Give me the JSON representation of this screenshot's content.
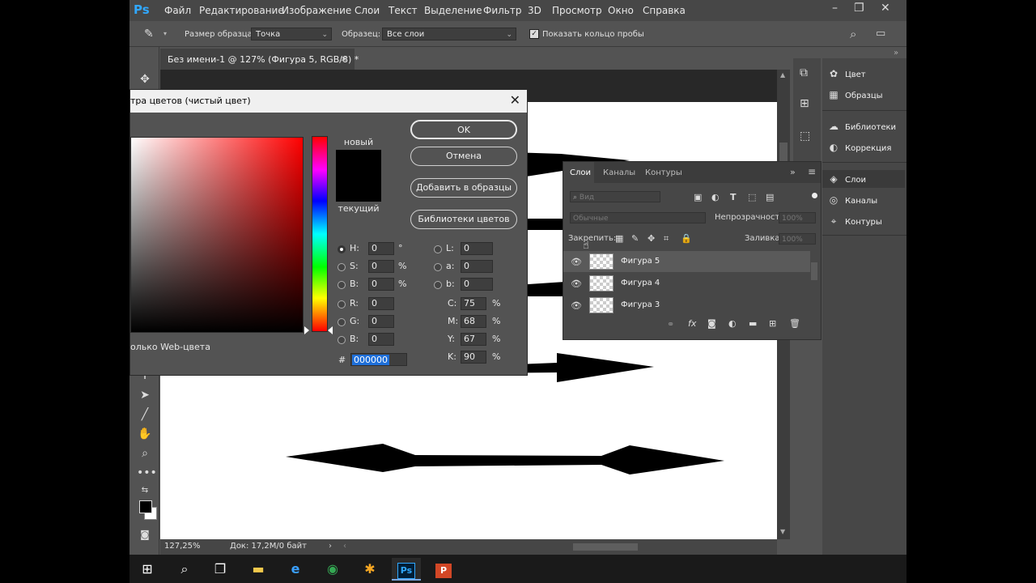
{
  "menubar": {
    "logo": "Ps",
    "items": [
      "Файл",
      "Редактирование",
      "Изображение",
      "Слои",
      "Текст",
      "Выделение",
      "Фильтр",
      "3D",
      "Просмотр",
      "Окно",
      "Справка"
    ]
  },
  "options_bar": {
    "sample_size_label": "Размер образца:",
    "sample_size_value": "Точка",
    "sample_label": "Образец:",
    "sample_value": "Все слои",
    "show_ring_label": "Показать кольцо пробы"
  },
  "document": {
    "tab_title": "Без имени-1 @ 127% (Фигура 5, RGB/8) *",
    "zoom": "127,25%",
    "doc_info": "Док: 17,2M/0 байт"
  },
  "color_picker": {
    "title": "тра цветов (чистый цвет)",
    "new_label": "новый",
    "current_label": "текущий",
    "ok_button": "OK",
    "cancel_button": "Отмена",
    "add_to_swatches_button": "Добавить в образцы",
    "color_libraries_button": "Библиотеки цветов",
    "only_web_colors": "олько Web-цвета",
    "fields": {
      "H": {
        "label": "H:",
        "value": "0",
        "unit": "°"
      },
      "S": {
        "label": "S:",
        "value": "0",
        "unit": "%"
      },
      "B": {
        "label": "B:",
        "value": "0",
        "unit": "%"
      },
      "R": {
        "label": "R:",
        "value": "0"
      },
      "G": {
        "label": "G:",
        "value": "0"
      },
      "Bb": {
        "label": "B:",
        "value": "0"
      },
      "L": {
        "label": "L:",
        "value": "0"
      },
      "a": {
        "label": "a:",
        "value": "0"
      },
      "b": {
        "label": "b:",
        "value": "0"
      },
      "C": {
        "label": "C:",
        "value": "75",
        "unit": "%"
      },
      "M": {
        "label": "M:",
        "value": "68",
        "unit": "%"
      },
      "Y": {
        "label": "Y:",
        "value": "67",
        "unit": "%"
      },
      "K": {
        "label": "K:",
        "value": "90",
        "unit": "%"
      }
    },
    "hash_label": "#",
    "hex_value": "000000",
    "current_color": "#000000",
    "new_color": "#000000"
  },
  "layers_panel": {
    "tabs": [
      "Слои",
      "Каналы",
      "Контуры"
    ],
    "search_placeholder": "Вид",
    "blend_mode": "Обычные",
    "opacity_label": "Непрозрачность:",
    "opacity_value": "100%",
    "lock_label": "Закрепить:",
    "fill_label": "Заливка:",
    "fill_value": "100%",
    "layers": [
      {
        "name": "Фигура 5",
        "selected": true
      },
      {
        "name": "Фигура 4",
        "selected": false
      },
      {
        "name": "Фигура 3",
        "selected": false
      }
    ]
  },
  "right_dock": {
    "items": [
      {
        "label": "Цвет",
        "icon": "palette-icon"
      },
      {
        "label": "Образцы",
        "icon": "grid-icon"
      },
      {
        "label": "Библиотеки",
        "icon": "cloud-icon"
      },
      {
        "label": "Коррекция",
        "icon": "adjust-icon"
      },
      {
        "label": "Слои",
        "icon": "layers-icon"
      },
      {
        "label": "Каналы",
        "icon": "channels-icon"
      },
      {
        "label": "Контуры",
        "icon": "paths-icon"
      }
    ]
  },
  "taskbar": {
    "ps_label": "Ps",
    "ppt_label": "P"
  }
}
